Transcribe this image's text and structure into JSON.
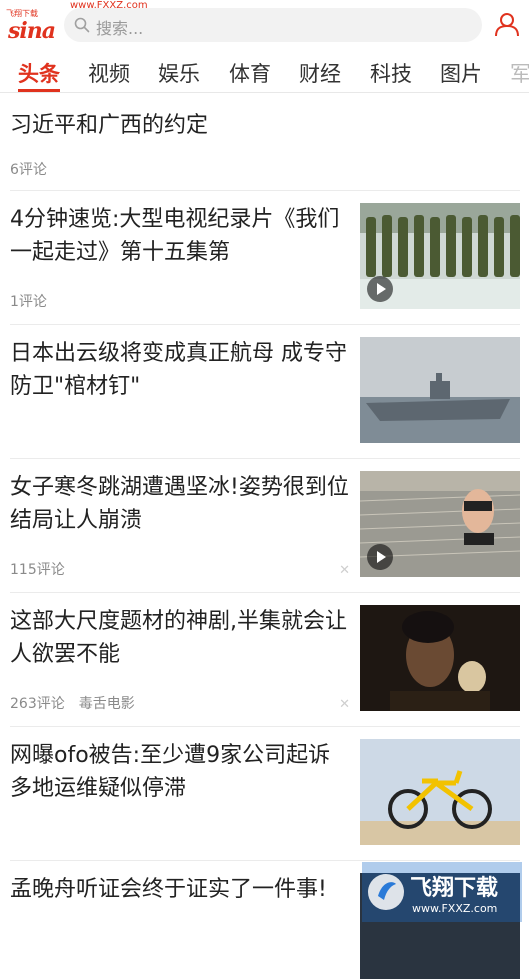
{
  "watermark_top": "飞翔下载",
  "watermark_top_url": "www.FXXZ.com",
  "logo": "sina",
  "search": {
    "placeholder": "搜索..."
  },
  "tabs": [
    "头条",
    "视频",
    "娱乐",
    "体育",
    "财经",
    "科技",
    "图片",
    "军"
  ],
  "active_tab": 0,
  "articles": [
    {
      "title": "习近平和广西的约定",
      "comments": "6评论",
      "source": ""
    },
    {
      "title": "4分钟速览:大型电视纪录片《我们一起走过》第十五集第",
      "comments": "1评论",
      "source": "",
      "video": true
    },
    {
      "title": "日本出云级将变成真正航母 成专守防卫\"棺材钉\"",
      "comments": "",
      "source": ""
    },
    {
      "title": "女子寒冬跳湖遭遇坚冰!姿势很到位结局让人崩溃",
      "comments": "115评论",
      "source": "",
      "video": true
    },
    {
      "title": "这部大尺度题材的神剧,半集就会让人欲罢不能",
      "comments": "263评论",
      "source": "毒舌电影"
    },
    {
      "title": "网曝ofo被告:至少遭9家公司起诉 多地运维疑似停滞",
      "comments": "",
      "source": ""
    },
    {
      "title": "孟晚舟听证会终于证实了一件事!",
      "comments": "",
      "source": ""
    }
  ],
  "watermark_bottom": {
    "text": "飞翔下载",
    "url": "www.FXXZ.com"
  },
  "colors": {
    "accent": "#e0321e",
    "text": "#222222",
    "meta": "#8a8a8a"
  }
}
